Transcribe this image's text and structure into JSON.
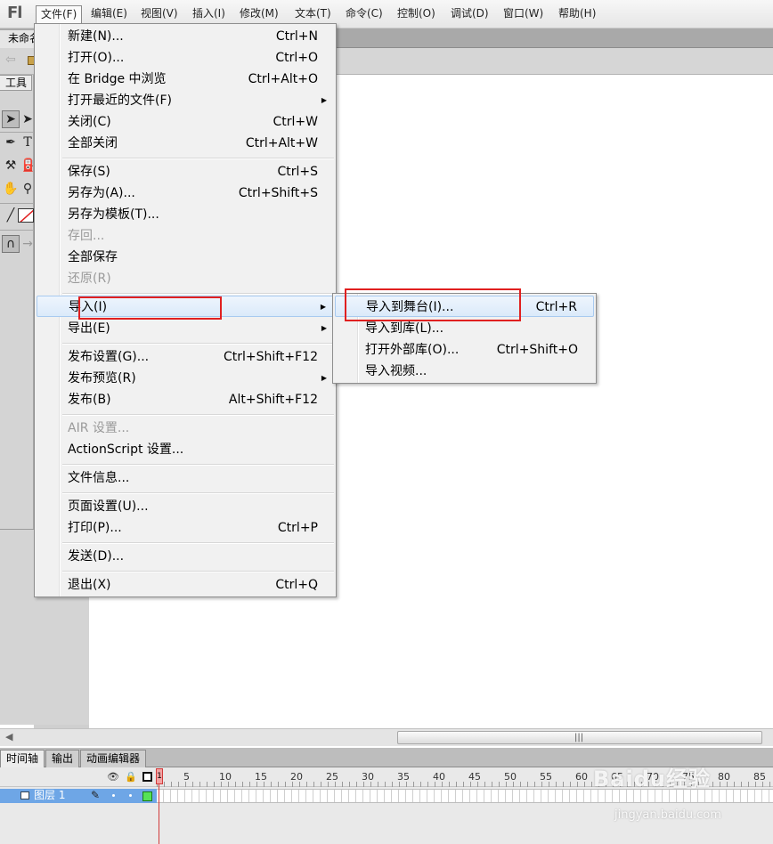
{
  "app": {
    "logo": "Fl",
    "doc_tab": "未命名"
  },
  "menubar": [
    {
      "label": "文件(F)",
      "active": true
    },
    {
      "label": "编辑(E)"
    },
    {
      "label": "视图(V)"
    },
    {
      "label": "插入(I)"
    },
    {
      "label": "修改(M)"
    },
    {
      "label": "文本(T)"
    },
    {
      "label": "命令(C)"
    },
    {
      "label": "控制(O)"
    },
    {
      "label": "调试(D)"
    },
    {
      "label": "窗口(W)"
    },
    {
      "label": "帮助(H)"
    }
  ],
  "toolbox": {
    "title": "工具",
    "text_tool": "T"
  },
  "file_menu": {
    "items": [
      {
        "label": "新建(N)...",
        "shortcut": "Ctrl+N"
      },
      {
        "label": "打开(O)...",
        "shortcut": "Ctrl+O"
      },
      {
        "label": "在 Bridge 中浏览",
        "shortcut": "Ctrl+Alt+O"
      },
      {
        "label": "打开最近的文件(F)",
        "shortcut": "",
        "submenu": true
      },
      {
        "label": "关闭(C)",
        "shortcut": "Ctrl+W"
      },
      {
        "label": "全部关闭",
        "shortcut": "Ctrl+Alt+W"
      },
      {
        "label": "保存(S)",
        "shortcut": "Ctrl+S"
      },
      {
        "label": "另存为(A)...",
        "shortcut": "Ctrl+Shift+S"
      },
      {
        "label": "另存为模板(T)...",
        "shortcut": ""
      },
      {
        "label": "存回...",
        "shortcut": "",
        "disabled": true
      },
      {
        "label": "全部保存",
        "shortcut": ""
      },
      {
        "label": "还原(R)",
        "shortcut": "",
        "disabled": true
      },
      {
        "label": "导入(I)",
        "shortcut": "",
        "submenu": true,
        "highlighted": true
      },
      {
        "label": "导出(E)",
        "shortcut": "",
        "submenu": true
      },
      {
        "label": "发布设置(G)...",
        "shortcut": "Ctrl+Shift+F12"
      },
      {
        "label": "发布预览(R)",
        "shortcut": "",
        "submenu": true
      },
      {
        "label": "发布(B)",
        "shortcut": "Alt+Shift+F12"
      },
      {
        "label": "AIR 设置...",
        "shortcut": "",
        "disabled": true
      },
      {
        "label": "ActionScript 设置...",
        "shortcut": ""
      },
      {
        "label": "文件信息...",
        "shortcut": ""
      },
      {
        "label": "页面设置(U)...",
        "shortcut": ""
      },
      {
        "label": "打印(P)...",
        "shortcut": "Ctrl+P"
      },
      {
        "label": "发送(D)...",
        "shortcut": ""
      },
      {
        "label": "退出(X)",
        "shortcut": "Ctrl+Q"
      }
    ]
  },
  "import_submenu": {
    "items": [
      {
        "label": "导入到舞台(I)...",
        "shortcut": "Ctrl+R",
        "highlighted": true
      },
      {
        "label": "导入到库(L)...",
        "shortcut": ""
      },
      {
        "label": "打开外部库(O)...",
        "shortcut": "Ctrl+Shift+O"
      },
      {
        "label": "导入视频...",
        "shortcut": ""
      }
    ]
  },
  "timeline": {
    "tabs": [
      "时间轴",
      "输出",
      "动画编辑器"
    ],
    "playhead_frame": "1",
    "frame_numbers": [
      "5",
      "10",
      "15",
      "20",
      "25",
      "30",
      "35",
      "40",
      "45",
      "50",
      "55",
      "60",
      "65",
      "70",
      "75",
      "80",
      "85"
    ],
    "layer_name": "图层 1"
  },
  "watermark": {
    "brand": "Baidu经验",
    "url": "jingyan.baidu.com"
  },
  "colors": {
    "highlight_border": "#a8caf0",
    "annotation_red": "#e02020",
    "layer_selected": "#6ea6e6"
  }
}
